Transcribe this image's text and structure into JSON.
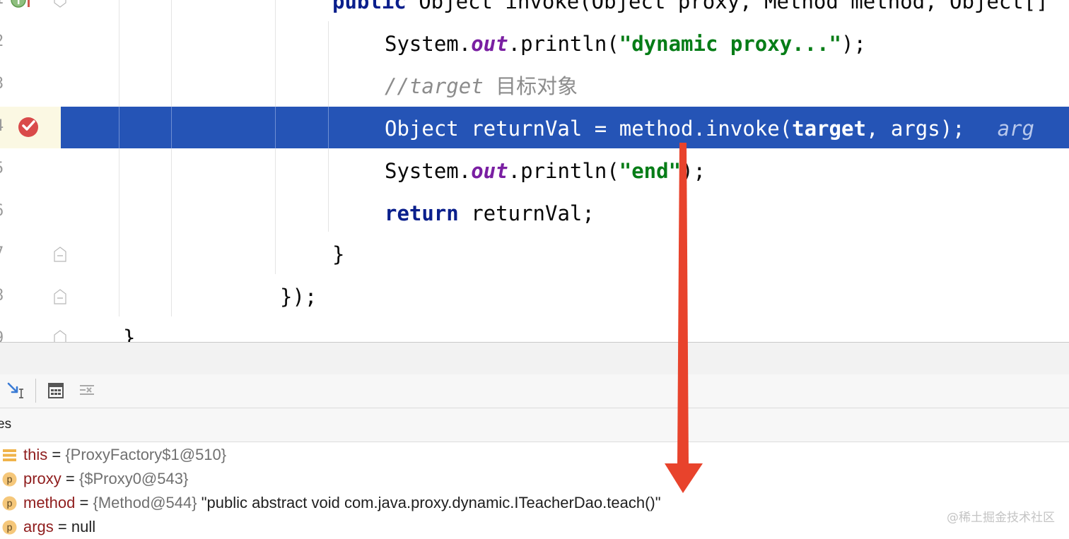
{
  "editor": {
    "gutter": {
      "line_numbers": [
        "1",
        "2",
        "3",
        "4",
        "5",
        "6",
        "7",
        "8",
        "9"
      ]
    },
    "code": {
      "line1": {
        "kw": "public",
        "rest": " Object invoke(Object proxy, Method method, Object[]"
      },
      "line2": {
        "prefix": "System.",
        "field": "out",
        "mid": ".println(",
        "str": "\"dynamic proxy...\"",
        "suffix": ");"
      },
      "line3": {
        "comment": "//target ",
        "comment_cjk": "目标对象"
      },
      "line4": {
        "a": "Object returnVal = method.invoke(",
        "target": "target",
        "b": ", args);",
        "hint": "arg"
      },
      "line5": {
        "prefix": "System.",
        "field": "out",
        "mid": ".println(",
        "str": "\"end\"",
        "suffix": ");"
      },
      "line6": {
        "kw": "return",
        "rest": " returnVal;"
      },
      "line7": {
        "text": "}"
      },
      "line8": {
        "text": "});"
      },
      "line9": {
        "text": "}"
      }
    }
  },
  "debugger": {
    "toolbar": {
      "buttons": [
        "run-to-cursor-icon",
        "evaluate-expression-icon",
        "trace-icon"
      ]
    },
    "variables": {
      "title": "es",
      "rows": [
        {
          "icon": "field-list-icon",
          "name": "this",
          "eq": " = ",
          "ref": "{ProxyFactory$1@510}",
          "value": ""
        },
        {
          "icon": "parameter-icon",
          "icon_letter": "p",
          "name": "proxy",
          "eq": " = ",
          "ref": "{$Proxy0@543}",
          "value": ""
        },
        {
          "icon": "parameter-icon",
          "icon_letter": "p",
          "name": "method",
          "eq": " = ",
          "ref": "{Method@544}",
          "value": " \"public abstract void com.java.proxy.dynamic.ITeacherDao.teach()\""
        },
        {
          "icon": "parameter-icon",
          "icon_letter": "p",
          "name": "args",
          "eq": " = ",
          "ref": "",
          "value": "null"
        }
      ]
    }
  },
  "watermark": "@稀土掘金技术社区",
  "colors": {
    "execution_line": "#2554b6",
    "arrow": "#e8432c",
    "breakpoint": "#d94a4a",
    "keyword": "#0a1f8c",
    "string": "#067d17",
    "field": "#7a1fa2"
  }
}
